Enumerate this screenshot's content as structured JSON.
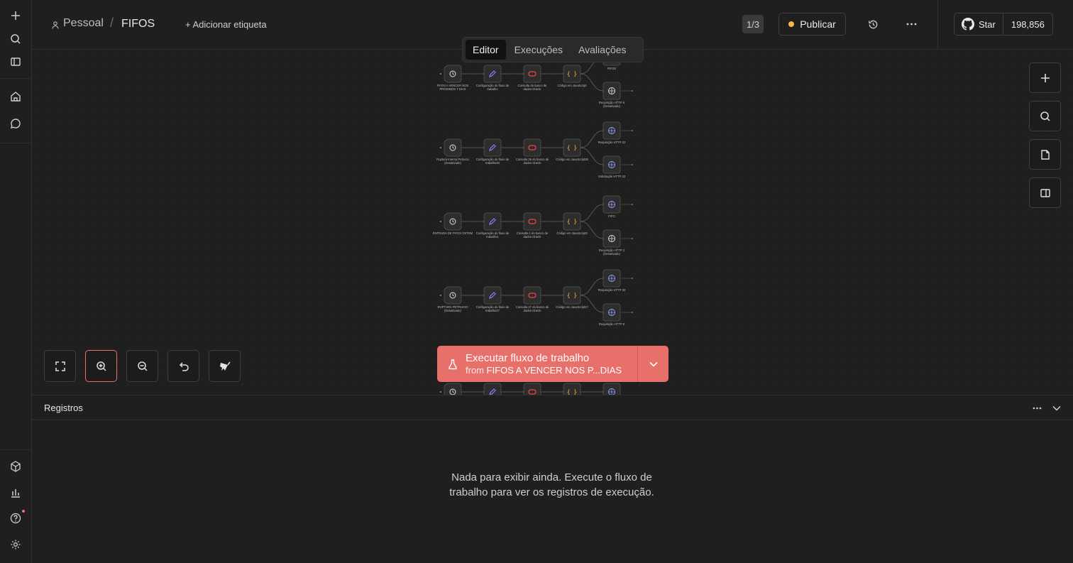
{
  "header": {
    "project": "Pessoal",
    "separator": "/",
    "workflow_name": "FIFOS",
    "add_tag": "+ Adicionar etiqueta",
    "page_indicator": "1/3",
    "publish": "Publicar",
    "github_star": "Star",
    "github_count": "198,856"
  },
  "tabs": [
    "Editor",
    "Execuções",
    "Avaliações"
  ],
  "active_tab": "Editor",
  "run": {
    "label": "Executar fluxo de trabalho",
    "from_prefix": "from",
    "from_node": "FIFOS A VENCER NOS P...DIAS"
  },
  "logs": {
    "title": "Registros",
    "empty": "Nada para exibir ainda. Execute o fluxo de trabalho para ver os registros de execução."
  },
  "workflow_rows": [
    {
      "trigger": "FIFOS A VENCER NOS PRÓXIMOS 7 DIAS",
      "config": "Configuração do fluxo de trabalho",
      "db": "Consulta do banco de dados Oracle",
      "code": "Código em JavaScript",
      "http_a": "FIFOS",
      "http_b": "Requisição HTTP 5 (Desativado)"
    },
    {
      "trigger": "Ruptura Interna Petrucio (Desativado)",
      "config": "Configuração do fluxo de trabalho26",
      "db": "Consulta 26 do banco de dados Oracle",
      "code": "Código em JavaScript26",
      "http_a": "Requisição HTTP 22",
      "http_b": "Solicitação HTTP 23"
    },
    {
      "trigger": "ENTRADA DE FIFOS CNTEM",
      "config": "Configuração do fluxo de trabalho1",
      "db": "Consulta 1 do banco de dados Oracle",
      "code": "Código em JavaScript3",
      "http_a": "FIFO",
      "http_b": "Requisição HTTP 2 (Desativado)"
    },
    {
      "trigger": "RUPTURA PETRUCIO (Desativado)",
      "config": "Configuração do fluxo de trabalho27",
      "db": "Consulta 27 do banco de dados Oracle",
      "code": "Código em JavaScript27",
      "http_a": "Requisição HTTP 20",
      "http_b": "Requisição HTTP 8"
    }
  ],
  "colors": {
    "accent": "#e8706a",
    "publish_dot": "#f5b841",
    "code": "#f5b841",
    "db": "#e8453c",
    "edit": "#8e7cf0",
    "trigger": "#3ecf8e",
    "http": "#8a9cf5"
  }
}
